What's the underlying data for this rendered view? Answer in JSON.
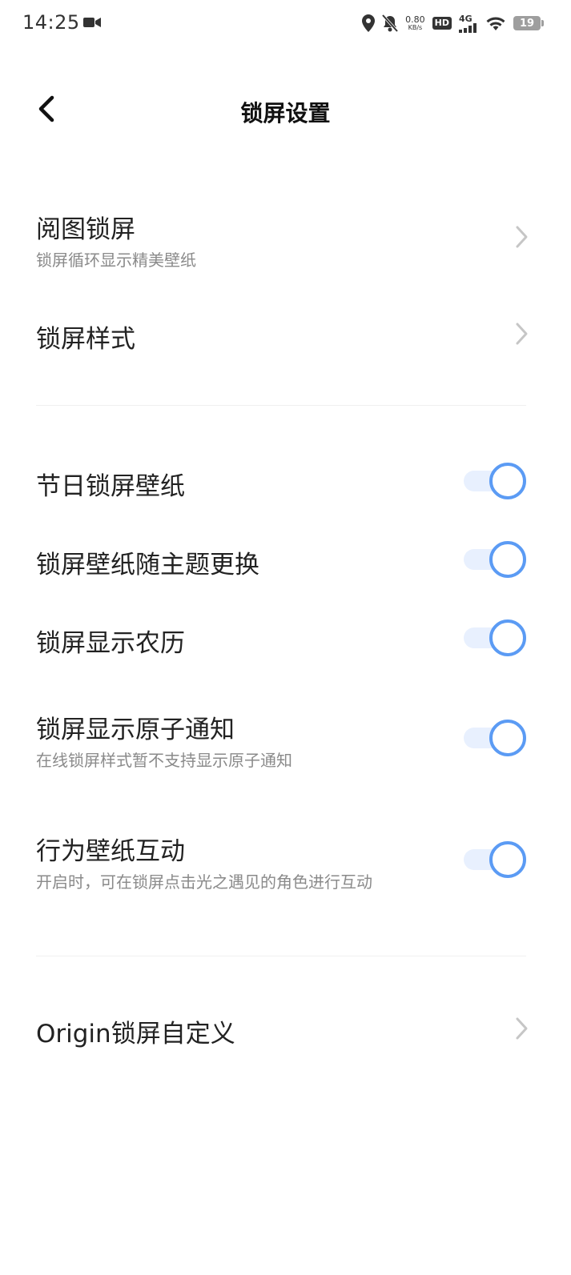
{
  "status_bar": {
    "time": "14:25",
    "speed_value": "0.80",
    "speed_unit": "KB/s",
    "hd_label": "HD",
    "network_label": "4G",
    "battery_level": "19"
  },
  "header": {
    "title": "锁屏设置"
  },
  "nav_rows": [
    {
      "title": "阅图锁屏",
      "subtitle": "锁屏循环显示精美壁纸"
    },
    {
      "title": "锁屏样式"
    }
  ],
  "toggle_rows": [
    {
      "title": "节日锁屏壁纸",
      "enabled": true
    },
    {
      "title": "锁屏壁纸随主题更换",
      "enabled": true
    },
    {
      "title": "锁屏显示农历",
      "enabled": true
    },
    {
      "title": "锁屏显示原子通知",
      "subtitle": "在线锁屏样式暂不支持显示原子通知",
      "enabled": true
    },
    {
      "title": "行为壁纸互动",
      "subtitle": "开启时，可在锁屏点击光之遇见的角色进行互动",
      "enabled": true
    }
  ],
  "custom_row": {
    "title": "Origin锁屏自定义"
  },
  "colors": {
    "accent": "#5b9bf4",
    "toggle_track": "#e8f0fe",
    "subtitle_text": "#8a8a8a"
  }
}
